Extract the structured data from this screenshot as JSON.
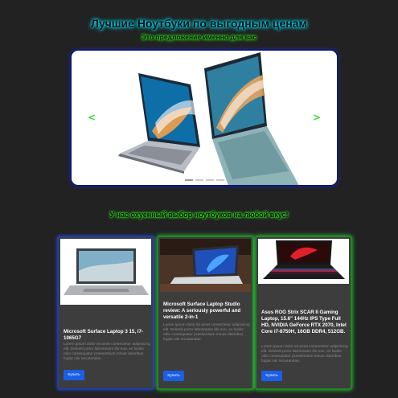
{
  "hero": {
    "title": "Лучшие Ноутбуки по выгодным ценам",
    "subtitle": "Это предложение именно для вас"
  },
  "slider": {
    "prev_icon": "chevron-left-icon",
    "next_icon": "chevron-right-icon",
    "prev_label": "<",
    "next_label": ">",
    "dot_count": 4,
    "active_dot": 1
  },
  "section": {
    "title": "У нас охуенный выбор ноутбуков на любой вкус!"
  },
  "colors": {
    "background": "#222222",
    "title_glow": "#00e5ff",
    "subtitle_glow": "#39ff14",
    "button": "#1a5fe6",
    "card_bg": "#3d3d3d"
  },
  "products": [
    {
      "title": "Microsoft Surface Laptop 3 15, i7-1065G7",
      "text": "Lorem ipsum dolor sit amet consectetur adipisicing elit. Deleniti porro laboriosam illo non, ex facilis odio consequatur praesentium minus doloribus fugiat nisi recusandae.",
      "button": "Купить"
    },
    {
      "title": "Microsoft Surface Laptop Studio review: A seriously powerful and versatile 2-in-1",
      "text": "Lorem ipsum dolor sit amet consectetur adipisicing elit. Deleniti porro laboriosam illo non, ex facilis odio consequatur praesentium minus doloribus fugiat nisi recusandae.",
      "button": "Купить"
    },
    {
      "title": "Asus ROG Strix SCAR II Gaming Laptop, 15.6\" 144Hz IPS Type Full HD, NVIDIA GeForce RTX 2070, Intel Core i7-8750H, 16GB DDR4, 512GB.",
      "text": "Lorem ipsum dolor sit amet consectetur adipisicing elit. Deleniti porro laboriosam illo non, ex facilis odio consequatur praesentium minus doloribus fugiat nisi recusandae.",
      "button": "Купить"
    }
  ]
}
